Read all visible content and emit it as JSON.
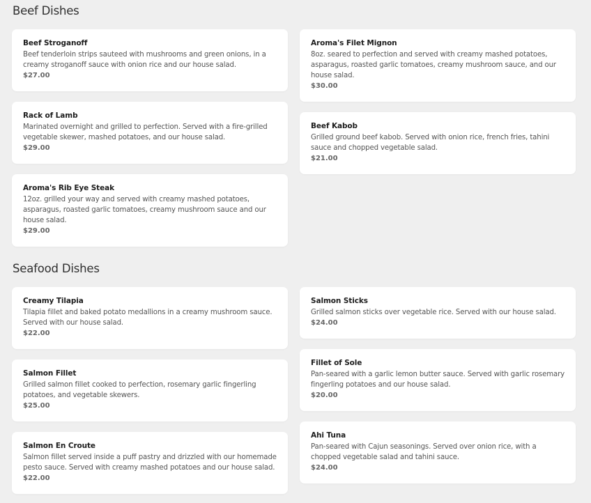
{
  "sections": {
    "beef": {
      "title": "Beef Dishes",
      "items": [
        {
          "name": "Beef Stroganoff",
          "desc": "Beef tenderloin strips sauteed with mushrooms and green onions, in a creamy stroganoff sauce with onion rice and our house salad.",
          "price": "$27.00"
        },
        {
          "name": "Aroma's Filet Mignon",
          "desc": "8oz. seared to perfection and served with creamy mashed potatoes, asparagus, roasted garlic tomatoes, creamy mushroom sauce, and our house salad.",
          "price": "$30.00"
        },
        {
          "name": "Rack of Lamb",
          "desc": "Marinated overnight and grilled to perfection. Served with a fire-grilled vegetable skewer, mashed potatoes, and our house salad.",
          "price": "$29.00"
        },
        {
          "name": "Beef Kabob",
          "desc": "Grilled ground beef kabob. Served with onion rice, french fries, tahini sauce and chopped vegetable salad.",
          "price": "$21.00"
        },
        {
          "name": "Aroma's Rib Eye Steak",
          "desc": "12oz. grilled your way and served with creamy mashed potatoes, asparagus, roasted garlic tomatoes, creamy mushroom sauce and our house salad.",
          "price": "$29.00"
        }
      ]
    },
    "seafood": {
      "title": "Seafood Dishes",
      "items": [
        {
          "name": "Creamy Tilapia",
          "desc": "Tilapia fillet and baked potato medallions in a creamy mushroom sauce. Served with our house salad.",
          "price": "$22.00"
        },
        {
          "name": "Salmon Sticks",
          "desc": "Grilled salmon sticks over vegetable rice. Served with our house salad.",
          "price": "$24.00"
        },
        {
          "name": "Salmon Fillet",
          "desc": "Grilled salmon fillet cooked to perfection, rosemary garlic fingerling potatoes, and vegetable skewers.",
          "price": "$25.00"
        },
        {
          "name": "Fillet of Sole",
          "desc": "Pan-seared with a garlic lemon butter sauce. Served with garlic rosemary fingerling potatoes and our house salad.",
          "price": "$20.00"
        },
        {
          "name": "Salmon En Croute",
          "desc": "Salmon fillet served inside a puff pastry and drizzled with our homemade pesto sauce. Served with creamy mashed potatoes and our house salad.",
          "price": "$22.00"
        },
        {
          "name": "Ahi Tuna",
          "desc": "Pan-seared with Cajun seasonings. Served over onion rice, with a chopped vegetable salad and tahini sauce.",
          "price": "$24.00"
        }
      ]
    }
  },
  "colors": {
    "background": "#efefef",
    "card": "#ffffff",
    "title": "#2f2f2f",
    "name": "#1d1d1d",
    "desc": "#555555",
    "price": "#666666"
  }
}
